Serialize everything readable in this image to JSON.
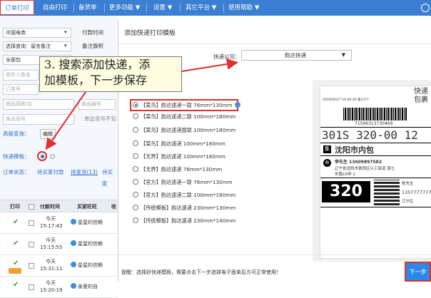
{
  "topbar": {
    "tabs": [
      {
        "label": "订单打印"
      },
      {
        "label": "自由打印"
      },
      {
        "label": "备货单"
      },
      {
        "label": "更多功能 ▼"
      },
      {
        "label": "设置 ▼"
      },
      {
        "label": "其它平台 ▼"
      },
      {
        "label": "使用帮助 ▼"
      }
    ]
  },
  "sidebar": {
    "shop_select": "中国电商",
    "pay_time": "付款时间",
    "memo_select": "选择查询：留言备注",
    "memo_btn": "备注旗帜",
    "all_select": "全部包",
    "recipient_placeholder": "收件人姓名",
    "order_no_placeholder": "订单号",
    "goods_placeholder": "商品简称/名",
    "goods_code_placeholder": "商品编号",
    "single_no": "单品货号",
    "single_no2": "单品货号不包",
    "advanced": "高级查询：",
    "reset": "编辑",
    "template_label": "快递模板：",
    "status_label": "订单状态：",
    "status_items": [
      "待买家付款",
      "待发货(13)",
      "待买家"
    ],
    "columns": [
      "打印",
      "付款时间",
      "买家旺旺",
      "收"
    ],
    "rows": [
      {
        "day": "今天",
        "time": "15:17:43",
        "buyer": "星星的信赖"
      },
      {
        "day": "今天",
        "time": "15:15:55",
        "buyer": "星星的信赖"
      },
      {
        "day": "今天",
        "time": "15:31:11",
        "buyer": "星星的信赖"
      },
      {
        "day": "今天",
        "time": "15:20:19",
        "buyer": "亲爱的自"
      }
    ]
  },
  "modal": {
    "title": "添加快递打印模板",
    "express_label": "快递公司：",
    "express_value": "韵达快递",
    "options": [
      "【菜鸟】韵达速递一联 76mm*130mm",
      "【菜鸟】韵达速递二联 100mm*180mm",
      "【菜鸟】韵达速递面联 100mm*180mm",
      "【菜鸟】韵达速递 100mm*180mm",
      "【无界】韵达速递 100mm*180mm",
      "【无界】韵达速递 76mm*130mm",
      "【官方】韵达速递一联 76mm*130mm",
      "【官方】韵达速递二联 100mm*180mm",
      "【传统模板】韵达速递 230mm*130mm",
      "【传统模板】韵达速递 230mm*140mm"
    ],
    "hint": "提醒：选择好快递模板，需要点击下一步选择电子面单后方可正常使用！",
    "next": "下一步"
  },
  "callout": {
    "line1": "3. 搜索添加快递，添",
    "line2": "加模板，下一步保存"
  },
  "label": {
    "date": "2019/05/27  10:00:26  第1/1个",
    "brand1": "快递",
    "brand2": "包裹",
    "barcode_no": "71566313730469",
    "code": "301S 320-00 12",
    "area_tag": "集",
    "area": "沈阳市内包",
    "recipient_tag": "收",
    "recipient": "李先生   13609897582",
    "addr1": "辽宁省沈阳市铁西区兴工街道 南七",
    "addr2": "东路10甲-1",
    "big_code": "320",
    "sender1": "陈先生",
    "sender2": "1357777777",
    "sender3": "江宁区"
  },
  "colors": {
    "accent": "#3a7fd1",
    "highlight": "#e03030",
    "button": "#2a88e6"
  }
}
